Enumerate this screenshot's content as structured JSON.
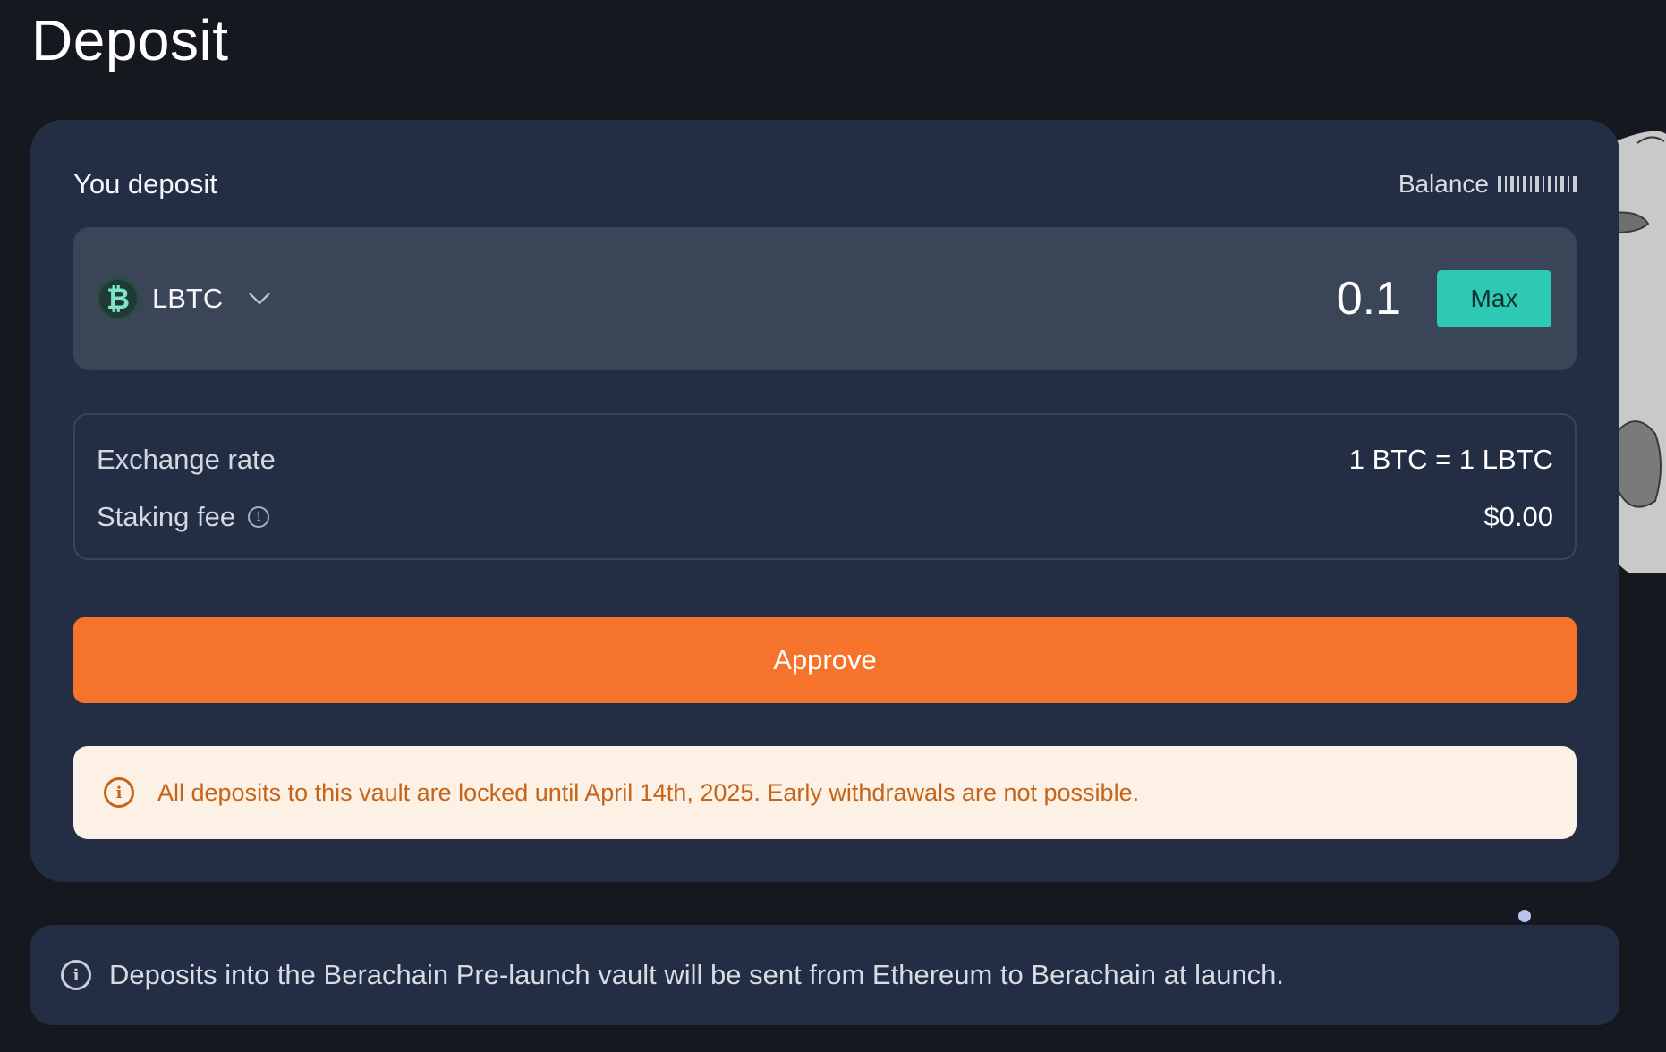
{
  "page": {
    "title": "Deposit"
  },
  "deposit_card": {
    "header_label": "You deposit",
    "balance_label": "Balance",
    "token": {
      "symbol": "LBTC",
      "icon": "bitcoin-icon"
    },
    "amount_value": "0.1",
    "max_label": "Max",
    "details": {
      "exchange_rate_label": "Exchange rate",
      "exchange_rate_value": "1 BTC = 1 LBTC",
      "staking_fee_label": "Staking fee",
      "staking_fee_value": "$0.00"
    },
    "approve_label": "Approve",
    "warning_text": "All deposits to this vault are locked until April 14th, 2025. Early withdrawals are not possible."
  },
  "footer_note": {
    "text": "Deposits into the Berachain Pre-launch vault will be sent from Ethereum to Berachain at launch."
  },
  "colors": {
    "background": "#161820",
    "card": "#232e44",
    "accent_max": "#2ec9b4",
    "approve": "#f5732a",
    "warning_bg": "#fdf0e4",
    "warning_text": "#c5651b"
  }
}
